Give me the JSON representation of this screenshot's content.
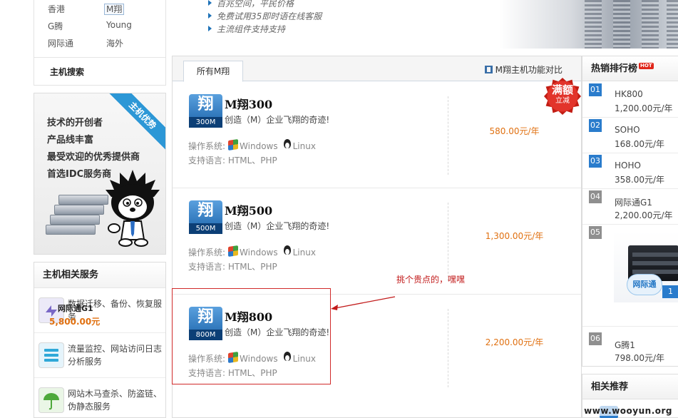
{
  "locations": [
    {
      "label": "香港",
      "selected": false
    },
    {
      "label": "M翔",
      "selected": true
    },
    {
      "label": "G腾",
      "selected": false
    },
    {
      "label": "Young",
      "selected": false
    },
    {
      "label": "网际通",
      "selected": false
    },
    {
      "label": "海外",
      "selected": false
    }
  ],
  "host_search_label": "主机搜索",
  "advantage": {
    "ribbon": "主机优势",
    "lines": [
      "技术的开创者",
      "产品线丰富",
      "最受欢迎的优秀提供商",
      "首选IDC服务商"
    ]
  },
  "services": {
    "title": "主机相关服务",
    "items": [
      {
        "text": "数据迁移、备份、恢复服务",
        "icon": "migrate-arrows-icon"
      },
      {
        "text": "流量监控、网站访问日志分析服务",
        "icon": "monitor-list-icon"
      },
      {
        "text": "网站木马查杀、防盗链、伪静态服务",
        "icon": "umbrella-icon"
      }
    ]
  },
  "banner": {
    "lines": [
      "百兆空间，平民价格",
      "免费试用35即时语在线客服",
      "主流组件支持支持"
    ]
  },
  "main": {
    "tab_all": "所有M翔",
    "compare_link": "M翔主机功能对比",
    "badge": {
      "big": "满额",
      "small": "立减"
    },
    "os_label": "操作系统:",
    "windows_label": "Windows",
    "linux_label": "Linux",
    "lang_label": "支持语言: HTML、PHP",
    "products": [
      {
        "name": "M翔300",
        "size": "300M",
        "slogan": "创造（M）企业飞翔的奇迹!",
        "price": "580.00元/年"
      },
      {
        "name": "M翔500",
        "size": "500M",
        "slogan": "创造（M）企业飞翔的奇迹!",
        "price": "1,300.00元/年"
      },
      {
        "name": "M翔800",
        "size": "800M",
        "slogan": "创造（M）企业飞翔的奇迹!",
        "price": "2,200.00元/年"
      }
    ],
    "annotation": "挑个贵点的，嘿嘿"
  },
  "ranking": {
    "title": "热销排行榜",
    "hot_tag": "HOT",
    "items": [
      {
        "rank": "01",
        "name": "HK800",
        "price": "1,200.00元/年"
      },
      {
        "rank": "02",
        "name": "SOHO",
        "price": "168.00元/年"
      },
      {
        "rank": "03",
        "name": "HOHO",
        "price": "358.00元/年"
      },
      {
        "rank": "04",
        "name": "网际通G1",
        "price": "2,200.00元/年"
      }
    ],
    "featured": {
      "rank": "05",
      "cloud_text": "网际通",
      "badge": "1",
      "name": "网际通G1",
      "price": "5,800.00元"
    },
    "last": {
      "rank": "06",
      "name": "G腾1",
      "price": "798.00元/年"
    }
  },
  "related": {
    "title": "相关推荐"
  },
  "watermark": "www.wooyun.org"
}
